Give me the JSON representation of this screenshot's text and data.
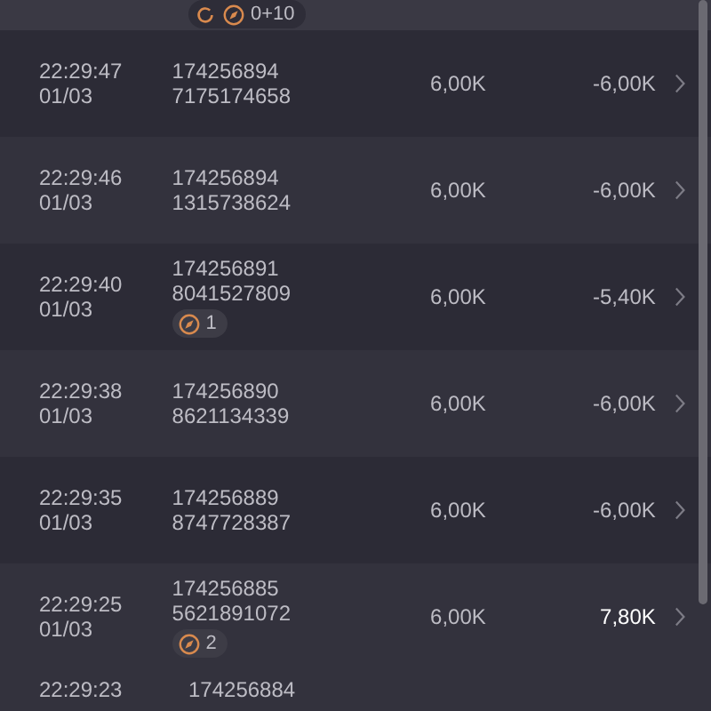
{
  "top_badge": {
    "text": "0+10"
  },
  "rows": [
    {
      "time": "22:29:47",
      "date": "01/03",
      "id_line_1": "174256894",
      "id_line_2": "7175174658",
      "amount": "6,00K",
      "result": "-6,00K",
      "positive": false
    },
    {
      "time": "22:29:46",
      "date": "01/03",
      "id_line_1": "174256894",
      "id_line_2": "1315738624",
      "amount": "6,00K",
      "result": "-6,00K",
      "positive": false
    },
    {
      "time": "22:29:40",
      "date": "01/03",
      "id_line_1": "174256891",
      "id_line_2": "8041527809",
      "badge": "1",
      "amount": "6,00K",
      "result": "-5,40K",
      "positive": false
    },
    {
      "time": "22:29:38",
      "date": "01/03",
      "id_line_1": "174256890",
      "id_line_2": "8621134339",
      "amount": "6,00K",
      "result": "-6,00K",
      "positive": false
    },
    {
      "time": "22:29:35",
      "date": "01/03",
      "id_line_1": "174256889",
      "id_line_2": "8747728387",
      "amount": "6,00K",
      "result": "-6,00K",
      "positive": false
    },
    {
      "time": "22:29:25",
      "date": "01/03",
      "id_line_1": "174256885",
      "id_line_2": "5621891072",
      "badge": "2",
      "amount": "6,00K",
      "result": "7,80K",
      "positive": true
    }
  ],
  "partial_row": {
    "time": "22:29:23",
    "id_line_1": "174256884"
  }
}
